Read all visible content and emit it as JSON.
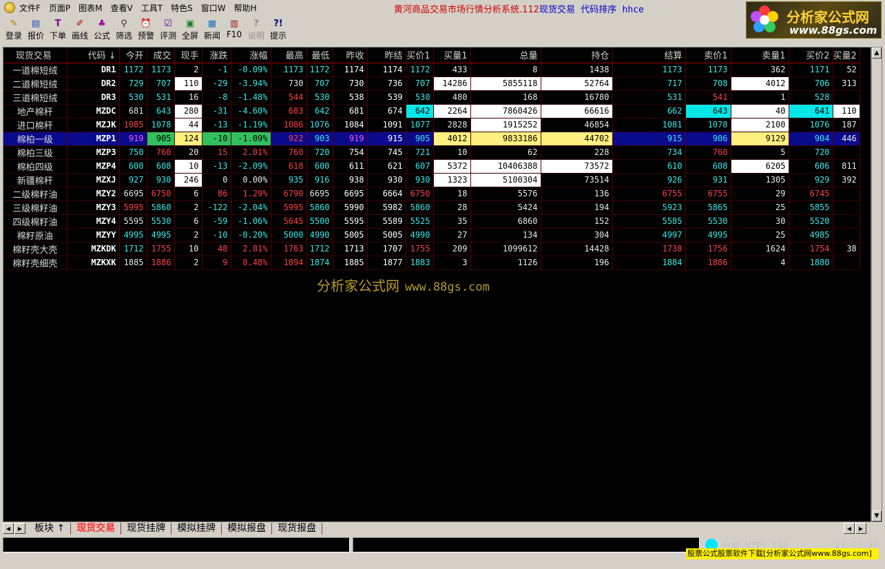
{
  "menubar": {
    "items": [
      "文件F",
      "页面P",
      "图表M",
      "查看V",
      "工具T",
      "特色S",
      "窗口W",
      "帮助H"
    ],
    "title_main": "黄河商品交易市场行情分析系统.112",
    "title_mode": "现货交易",
    "title_sort": "代码排序",
    "title_user": "hhce"
  },
  "toolbar": {
    "items": [
      {
        "label": "登录",
        "icon": "pencil-icon"
      },
      {
        "label": "报价",
        "icon": "quote-icon"
      },
      {
        "label": "下单",
        "icon": "order-icon"
      },
      {
        "label": "画线",
        "icon": "draw-line-icon"
      },
      {
        "label": "公式",
        "icon": "formula-icon"
      },
      {
        "label": "筛选",
        "icon": "filter-icon"
      },
      {
        "label": "预警",
        "icon": "alarm-icon"
      },
      {
        "label": "评测",
        "icon": "evaluate-icon"
      },
      {
        "label": "全屏",
        "icon": "fullscreen-icon"
      },
      {
        "label": "新闻",
        "icon": "news-icon"
      },
      {
        "label": "F10",
        "icon": "books-icon"
      },
      {
        "label": "说明",
        "icon": "help-doc-icon",
        "disabled": true
      },
      {
        "label": "提示",
        "icon": "hint-icon"
      }
    ]
  },
  "brand": {
    "name": "分析家公式网",
    "url": "www.88gs.com"
  },
  "table": {
    "headers": [
      "现货交易",
      "代码 ↓",
      "今开",
      "成交",
      "现手",
      "涨跌",
      "涨幅",
      "最高",
      "最低",
      "昨收",
      "昨结",
      "买价1",
      "买量1",
      "总量",
      "持仓",
      "结算",
      "卖价1",
      "卖量1",
      "买价2",
      "买量2"
    ],
    "rows": [
      [
        "一道棉短绒",
        "DR1",
        "1172",
        "1173",
        "2",
        "-1",
        "-0.09%",
        "1173",
        "1172",
        "1174",
        "1174",
        "1172",
        "433",
        "8",
        "1438",
        "1173",
        "1173",
        "362",
        "1171",
        "52"
      ],
      [
        "二道棉短绒",
        "DR2",
        "729",
        "707",
        "110",
        "-29",
        "-3.94%",
        "730",
        "707",
        "730",
        "736",
        "707",
        "14286",
        "5855118",
        "52764",
        "717",
        "708",
        "4012",
        "706",
        "313"
      ],
      [
        "三道棉短绒",
        "DR3",
        "530",
        "531",
        "16",
        "-8",
        "-1.48%",
        "544",
        "530",
        "538",
        "539",
        "530",
        "480",
        "168",
        "16780",
        "531",
        "541",
        "1",
        "528",
        ""
      ],
      [
        "地产棉秆",
        "MZDC",
        "681",
        "643",
        "280",
        "-31",
        "-4.60%",
        "683",
        "642",
        "681",
        "674",
        "642",
        "2264",
        "7860426",
        "66616",
        "662",
        "643",
        "40",
        "641",
        "110"
      ],
      [
        "进口棉秆",
        "MZJK",
        "1085",
        "1078",
        "44",
        "-13",
        "-1.19%",
        "1086",
        "1076",
        "1084",
        "1091",
        "1077",
        "2828",
        "1915252",
        "46854",
        "1081",
        "1078",
        "2100",
        "1076",
        "187"
      ],
      [
        "棉柏一级",
        "MZP1",
        "919",
        "905",
        "124",
        "-10",
        "-1.09%",
        "922",
        "903",
        "919",
        "915",
        "905",
        "4012",
        "9833186",
        "44702",
        "915",
        "906",
        "9129",
        "904",
        "446"
      ],
      [
        "棉柏三级",
        "MZP3",
        "750",
        "760",
        "20",
        "15",
        "2.01%",
        "760",
        "720",
        "754",
        "745",
        "721",
        "10",
        "62",
        "228",
        "734",
        "760",
        "5",
        "720",
        ""
      ],
      [
        "棉柏四级",
        "MZP4",
        "600",
        "608",
        "10",
        "-13",
        "-2.09%",
        "618",
        "600",
        "611",
        "621",
        "607",
        "5372",
        "10406388",
        "73572",
        "610",
        "608",
        "6205",
        "606",
        "811"
      ],
      [
        "新疆棉秆",
        "MZXJ",
        "927",
        "930",
        "246",
        "0",
        "0.00%",
        "935",
        "916",
        "938",
        "930",
        "930",
        "1323",
        "5100304",
        "73514",
        "926",
        "931",
        "1305",
        "929",
        "392"
      ],
      [
        "二级棉籽油",
        "MZY2",
        "6695",
        "6750",
        "6",
        "86",
        "1.29%",
        "6790",
        "6695",
        "6695",
        "6664",
        "6750",
        "18",
        "5576",
        "136",
        "6755",
        "6755",
        "29",
        "6745",
        ""
      ],
      [
        "三级棉籽油",
        "MZY3",
        "5995",
        "5860",
        "2",
        "-122",
        "-2.04%",
        "5995",
        "5860",
        "5990",
        "5982",
        "5860",
        "28",
        "5424",
        "194",
        "5923",
        "5865",
        "25",
        "5855",
        ""
      ],
      [
        "四级棉籽油",
        "MZY4",
        "5595",
        "5530",
        "6",
        "-59",
        "-1.06%",
        "5645",
        "5500",
        "5595",
        "5589",
        "5525",
        "35",
        "6860",
        "152",
        "5585",
        "5530",
        "30",
        "5520",
        ""
      ],
      [
        "棉籽原油",
        "MZYY",
        "4995",
        "4995",
        "2",
        "-10",
        "-0.20%",
        "5000",
        "4990",
        "5005",
        "5005",
        "4990",
        "27",
        "134",
        "304",
        "4997",
        "4995",
        "25",
        "4985",
        ""
      ],
      [
        "棉籽壳大壳",
        "MZKDK",
        "1712",
        "1755",
        "10",
        "48",
        "2.81%",
        "1763",
        "1712",
        "1713",
        "1707",
        "1755",
        "209",
        "1099612",
        "14428",
        "1738",
        "1756",
        "1624",
        "1754",
        "38"
      ],
      [
        "棉籽壳细壳",
        "MZKXK",
        "1885",
        "1886",
        "2",
        "9",
        "0.48%",
        "1894",
        "1874",
        "1885",
        "1877",
        "1883",
        "3",
        "1126",
        "196",
        "1884",
        "1886",
        "4",
        "1880",
        ""
      ]
    ],
    "selected_row": 5
  },
  "watermark": {
    "cn": "分析家公式网",
    "url": "www.88gs.com"
  },
  "tabs": [
    "板块 ↑",
    "现货交易",
    "现货挂牌",
    "模拟挂牌",
    "模拟报盘",
    "现货报盘"
  ],
  "active_tab": 1,
  "status": {
    "tick": "分笔:MZP1 146",
    "clock": "13:43:31",
    "ad": "股票公式股票软件下载[分析家公式网www.88gs.com]"
  },
  "colors": {
    "up": "#ff4040",
    "down": "#38e8e8",
    "selected_row_bg": "#0a0a8c",
    "grid_bg": "#000000"
  }
}
